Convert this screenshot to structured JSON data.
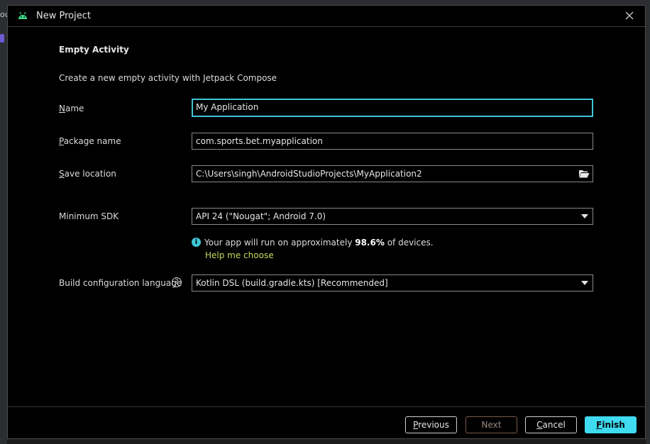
{
  "backdrop": {
    "glyph": "ou"
  },
  "window": {
    "title": "New Project"
  },
  "form": {
    "heading": "Empty Activity",
    "description": "Create a new empty activity with Jetpack Compose",
    "name": {
      "label_accel": "N",
      "label_rest": "ame",
      "value": "My Application"
    },
    "package": {
      "label_accel": "P",
      "label_rest": "ackage name",
      "value": "com.sports.bet.myapplication"
    },
    "save_location": {
      "label_accel": "S",
      "label_rest": "ave location",
      "value": "C:\\Users\\singh\\AndroidStudioProjects\\MyApplication2"
    },
    "min_sdk": {
      "label": "Minimum SDK",
      "value": "API 24 (\"Nougat\"; Android 7.0)"
    },
    "info": {
      "prefix": "Your app will run on approximately ",
      "percent": "98.6%",
      "suffix": " of devices.",
      "help_link": "Help me choose"
    },
    "build_lang": {
      "label": "Build configuration language",
      "value": "Kotlin DSL (build.gradle.kts) [Recommended]"
    }
  },
  "buttons": {
    "previous": {
      "accel": "P",
      "rest": "revious"
    },
    "next": "Next",
    "cancel": {
      "accel": "C",
      "rest": "ancel"
    },
    "finish": {
      "accel": "F",
      "rest": "inish"
    }
  },
  "colors": {
    "accent": "#3fc6d6",
    "primary_button": "#3fdbf0",
    "link": "#c6d85a",
    "background": "#000000"
  }
}
